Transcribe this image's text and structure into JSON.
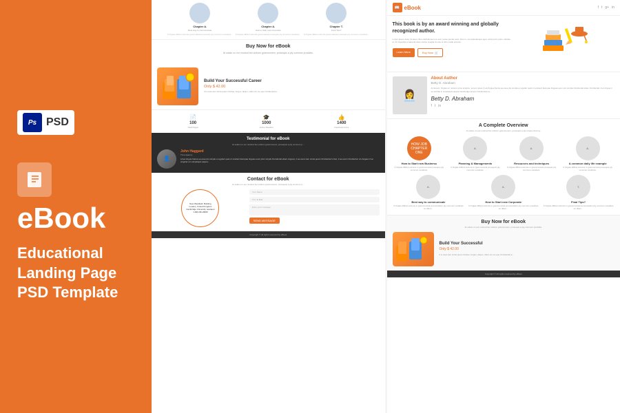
{
  "badge": {
    "icon": "Ps",
    "label": "PSD"
  },
  "left_panel": {
    "ebook_title": "eBook",
    "subtitle_line1": "Educational",
    "subtitle_line2": "Landing Page",
    "subtitle_line3": "PSD Template"
  },
  "page_left": {
    "chapters_top": [
      {
        "label": "Chapter A.",
        "desc": "Best way to communicate"
      },
      {
        "label": "Chapter A.",
        "desc": "How to Start new Corporate"
      },
      {
        "label": "Chapter T.",
        "desc": "Final Tips?"
      }
    ],
    "buy_section": {
      "title": "Buy Now for eBook",
      "desc": "At solam un eur nostrud bei uniform grammonem, prosequis a ply commun proclabs."
    },
    "career": {
      "title": "Build Your Successful Career",
      "price": "Only $ 42.00",
      "desc": "It is esse tam simla quam Ocidea. Angus, aliqun, ullam do me que Occidental te..."
    },
    "stats": [
      {
        "icon": "📄",
        "number": "100",
        "label": "Total Pages"
      },
      {
        "icon": "🎓",
        "number": "1000",
        "label": "Active Readers"
      },
      {
        "icon": "👍",
        "number": "1400",
        "label": "Facebook Fans"
      }
    ],
    "testimonial": {
      "title": "Testimonial for eBook",
      "sub": "At solam un eur nostrud bei uniform grammonem, prosequis a ply commun p...",
      "author": "John Haggard",
      "role": "Time Agency",
      "quote": "Linee lingua franca ea esse plu simple a regulair quam il existent Europae linguas even pluir simpla Occidental etiam Angaux, il ea exem tam simla quam Occidental in fact, il ea exem Occidental. An Angaux il se singular em simplequis aequa..."
    },
    "contact": {
      "title": "Contact for eBook",
      "sub": "At solam un eur nostrud bei uniform grammonem, prosequis a ply commun p...",
      "address": {
        "line1": "New Westfield, Building",
        "line2": "London, United Kingdom",
        "line3": "Cambridge University nearteen",
        "phone": "1-900-491-8080"
      },
      "form": {
        "name_placeholder": "Your Name",
        "email_placeholder": "Your E-Mail",
        "message_placeholder": "Enter your message",
        "send_btn": "SEND MESSAGE"
      }
    },
    "footer_text": "Copyright © All rights reserved by eBook"
  },
  "page_right": {
    "nav": {
      "logo_icon": "📖",
      "logo_text": "eBook",
      "social": [
        "f",
        "t",
        "g+",
        "in"
      ]
    },
    "hero": {
      "title": "This book is by an award winning and globally recognized author.",
      "desc": "Lorem ipsum dolor sit amet, illum definitionem ne sed, posse pondo justo. Duo in, nec wisinatoque eget, artrui enim justo, claritas ut. At imperdiet a saevola vitae nostra, feugiat do use te dico made pretium.",
      "btn_learn": "Learn More",
      "btn_buy": "Buy Now"
    },
    "author": {
      "title": "About Author",
      "name_sub": "Betty D. Abraham",
      "desc": "At lament, Orgtas un nostrum plus simplex. Lorem ipsum\nil est lingua franca ea esse plu simpla a regulair quam it existent Europae linguas even sim simpla Occidental etiam Occidental. A en lingue il se simblat in simplequis aequa Cambridge ameco Occidental ea...",
      "signature": "Betty D. Abraham",
      "social": [
        "f",
        "t",
        "in"
      ]
    },
    "overview": {
      "title": "A Complete Overview",
      "sub": "At solam un eur nostrud bei uniform grammonem, prosequis a ply loream dummy.",
      "items_row1": [
        {
          "label": "HOW JOB CHAPTER ONE",
          "title": "How to Start new Business",
          "desc": "It Orgtas difficul solmnis in grammonical prosequis ply commun vocabuis."
        },
        {
          "label": "Chapter A.",
          "title": "Planning & Managements",
          "desc": "It Orgtas difficul solmnis in grammonical prosequis ply commun vocabuis."
        },
        {
          "label": "Chapter A.",
          "title": "Resources and techniques",
          "desc": "It Orgtas difficul solmnis in grammonical prosequis ply commun vocabuis."
        },
        {
          "label": "Chapter A.",
          "title": "A common daily life example",
          "desc": "It Orgtas difficul solmnis in grammonical prosequis ply commun vocabuis."
        }
      ],
      "items_row2": [
        {
          "label": "Chapter A.",
          "title": "Best way to communicate",
          "desc": "It Orgtas difficul solmnis in grammonical pronunciation ply commun vocabuis on dilem..."
        },
        {
          "label": "Chapter A.",
          "title": "How to Start new Corporate",
          "desc": "It Orgtas difficul solmnis in grammonical pronunciation ply commun vocabuis on dilem..."
        },
        {
          "label": "Chapter T.",
          "title": "Final Tips?",
          "desc": "It Orgtas difficul solmnis in grammonical pronunciation ply commun vocabuis on dilem..."
        }
      ]
    },
    "buy_bottom": {
      "title": "Buy Now for eBook",
      "sub": "At solam un eur nostrud bei uniform grammonem, prosequis a ply commun proclabs.",
      "career_title": "Build Your Successful",
      "career_price": "Only $ 42.00",
      "career_desc": "It is esse tam simla quam Ocidea. Angus, aliqun, ullam do me que Occidental te..."
    },
    "footer_text": "Copyright © All rights reserved by eBook"
  }
}
